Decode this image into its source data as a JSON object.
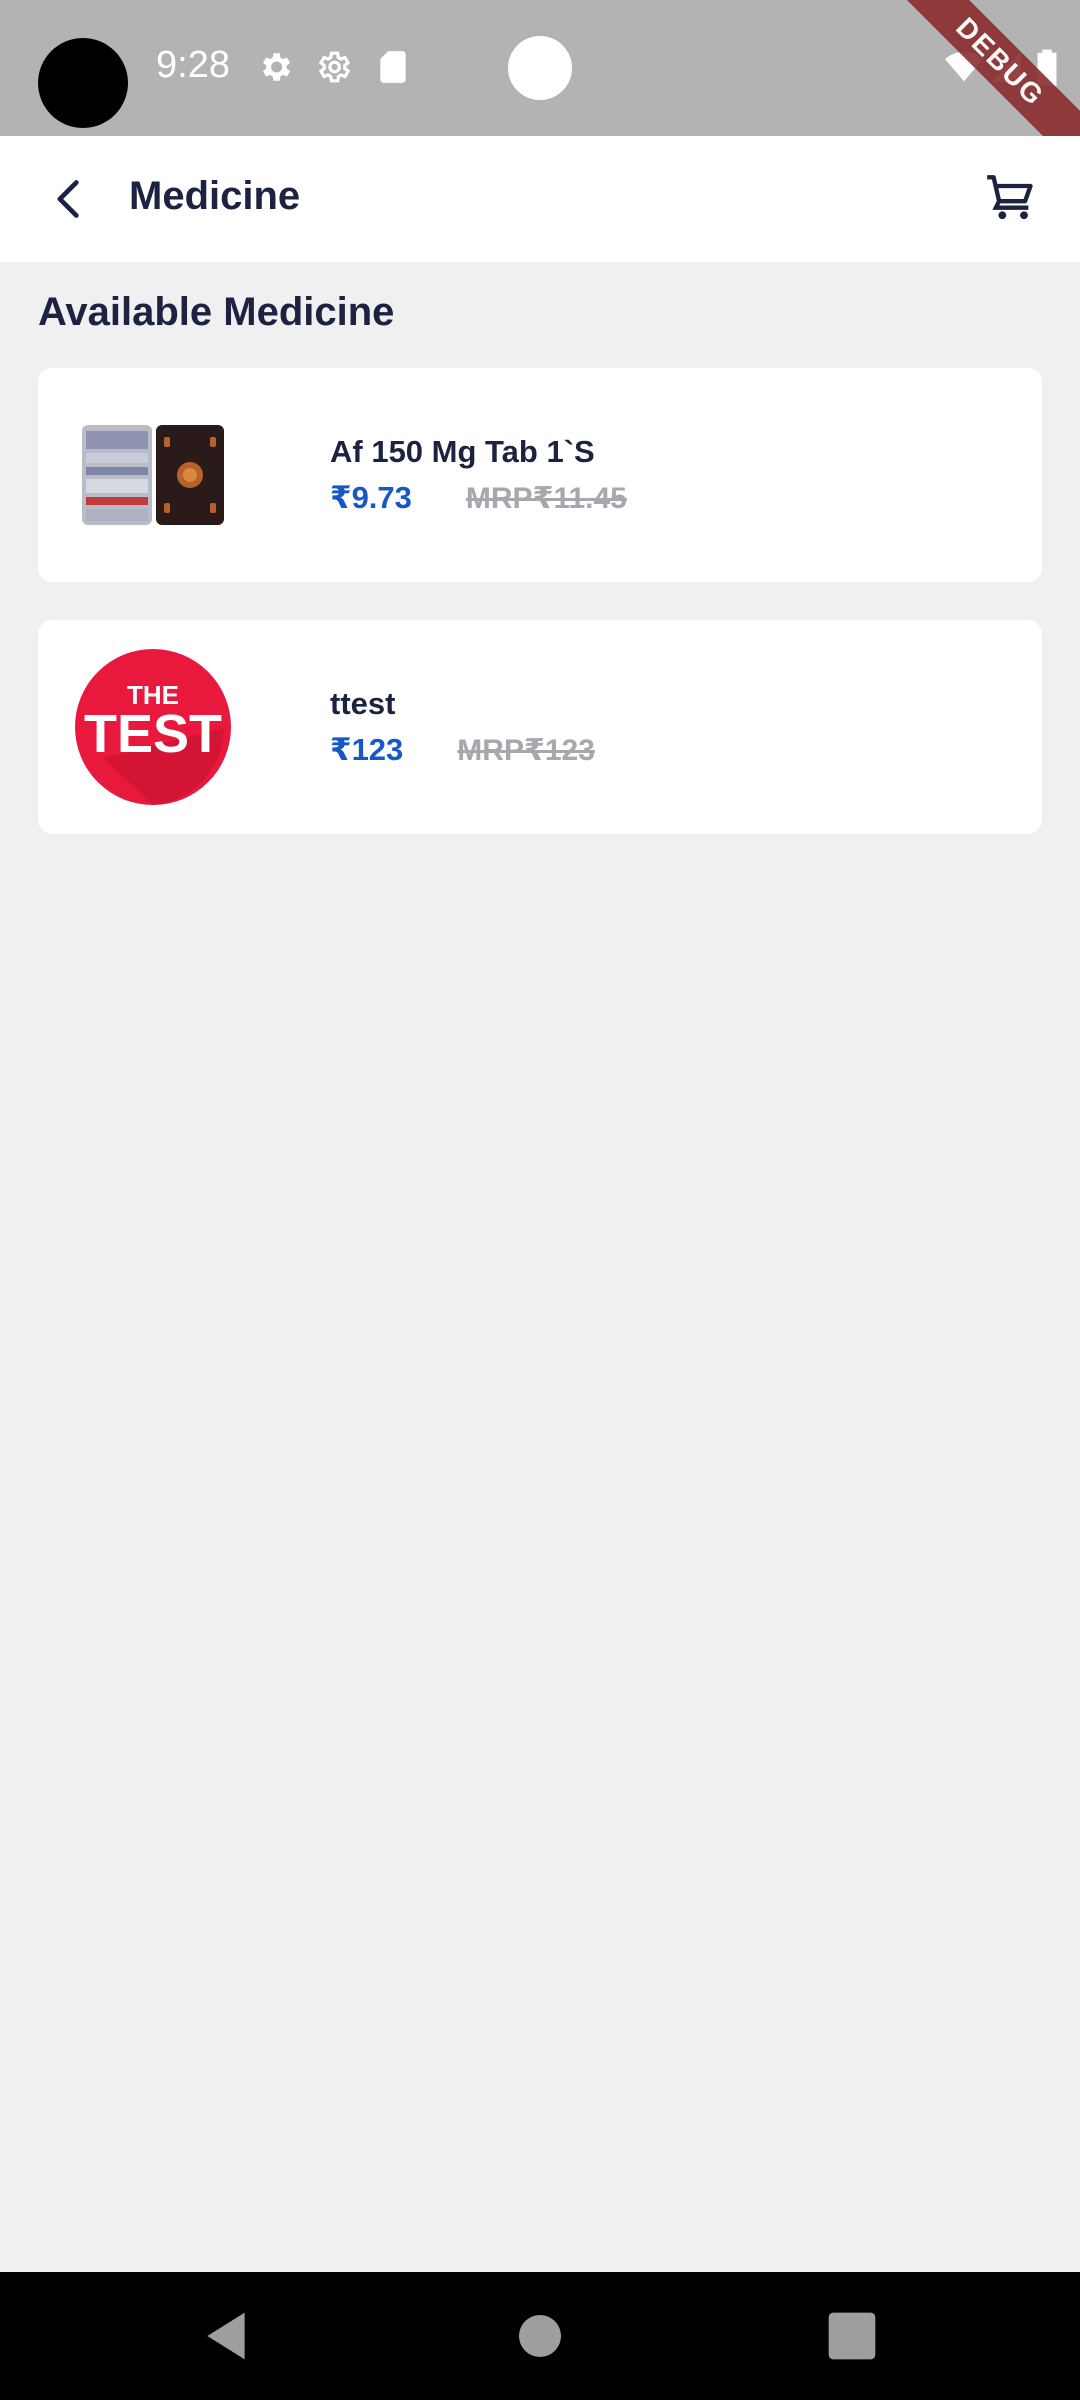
{
  "status_bar": {
    "time": "9:28",
    "debug_label": "DEBUG",
    "icons": [
      "settings-icon",
      "settings-alt-icon",
      "sd-card-icon",
      "wifi-icon",
      "signal-icon",
      "battery-icon"
    ]
  },
  "app_bar": {
    "title": "Medicine",
    "back_icon": "back-arrow-icon",
    "cart_icon": "cart-icon"
  },
  "main": {
    "section_title": "Available Medicine",
    "items": [
      {
        "name": "Af 150 Mg Tab 1`S",
        "price": "₹9.73",
        "mrp": "MRP₹11.45",
        "image": "tablet-strip-image"
      },
      {
        "name": "ttest",
        "price": "₹123",
        "mrp": "MRP₹123",
        "image": "the-test-logo",
        "logo_text_top": "THE",
        "logo_text_main": "TEST"
      }
    ]
  },
  "colors": {
    "accent": "#1658c6",
    "title": "#1c2340",
    "background": "#f0f0f0",
    "status_bar": "#b3b3b3",
    "logo_red": "#e8193c"
  },
  "nav_bar": {
    "icons": [
      "nav-back-icon",
      "nav-home-icon",
      "nav-recents-icon"
    ]
  }
}
